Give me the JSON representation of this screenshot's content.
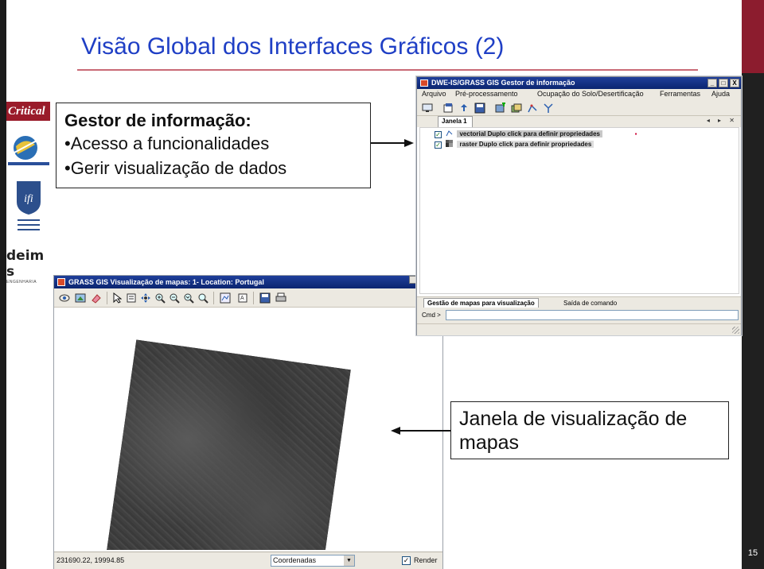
{
  "slide": {
    "title": "Visão Global dos Interfaces Gráficos (2)",
    "page_number": "15",
    "colors": {
      "title": "#1f3fc5",
      "accent_bar": "#8c1c2e",
      "rule": "#c96a76"
    }
  },
  "logos": {
    "critical": "Critical",
    "deimos": "deim s",
    "deimos_sub": "ENGENHARIA"
  },
  "callout_top": {
    "heading": "Gestor de informação:",
    "items": [
      "•Acesso a funcionalidades",
      "•Gerir visualização de dados"
    ]
  },
  "callout_bottom": {
    "text": "Janela de visualização de mapas"
  },
  "layer_manager": {
    "title": "DWE-IS/GRASS GIS Gestor de informação",
    "menu": [
      "Arquivo",
      "Pré-processamento",
      "Ocupação do Solo/Desertificação",
      "Ferramentas",
      "Ajuda"
    ],
    "tab": "Janela 1",
    "tab_nav": "◂ ▸ ✕",
    "layers": [
      {
        "type": "vectorial",
        "hint": "Duplo click para definir propriedades",
        "label": "vectorial Duplo click para definir propriedades"
      },
      {
        "type": "raster",
        "hint": "Duplo click para definir propriedades",
        "label": "raster Duplo click para definir propriedades"
      }
    ],
    "bottom_tabs": [
      "Gestão de mapas para visualização",
      "Saída de comando"
    ],
    "cmd_label": "Cmd >",
    "window_buttons": [
      "_",
      "□",
      "X"
    ]
  },
  "map_display": {
    "title": "GRASS GIS Visualização de mapas: 1- Location: Portugal",
    "coords": "231690.22, 19994.85",
    "coord_select": "Coordenadas",
    "render_label": "Render",
    "render_checked": true,
    "toolbar_icons": [
      "eye-icon",
      "render-icon",
      "erase-icon",
      "pointer-icon",
      "query-icon",
      "pan-icon",
      "zoom-in-icon",
      "zoom-out-icon",
      "zoom-back-icon",
      "zoom-menu-icon",
      "decoration-icon",
      "analyze-icon",
      "save-icon",
      "print-icon"
    ]
  }
}
